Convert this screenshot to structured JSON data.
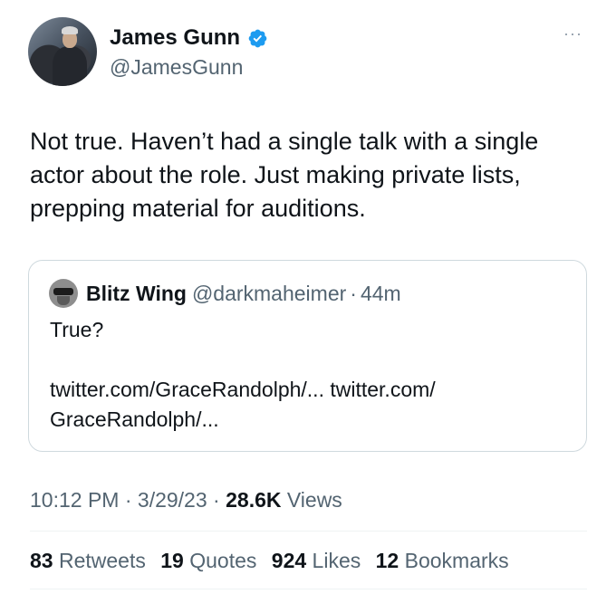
{
  "author": {
    "name": "James Gunn",
    "handle": "@JamesGunn",
    "verified_color": "#1d9bf0"
  },
  "menu": {
    "more_label": "···"
  },
  "tweet": {
    "text": "Not true. Haven’t had a single talk with a single actor about the role. Just making private lists, prepping material for auditions."
  },
  "quote": {
    "name": "Blitz Wing",
    "handle": "@darkmaheimer",
    "separator": "·",
    "time": "44m",
    "text": "True?",
    "links": "twitter.com/GraceRandolph/... twitter.com/ GraceRandolph/..."
  },
  "meta": {
    "time": "10:12 PM",
    "date": "3/29/23",
    "separator": "·",
    "views_count": "28.6K",
    "views_label": "Views"
  },
  "stats": [
    {
      "count": "83",
      "label": "Retweets"
    },
    {
      "count": "19",
      "label": "Quotes"
    },
    {
      "count": "924",
      "label": "Likes"
    },
    {
      "count": "12",
      "label": "Bookmarks"
    }
  ]
}
